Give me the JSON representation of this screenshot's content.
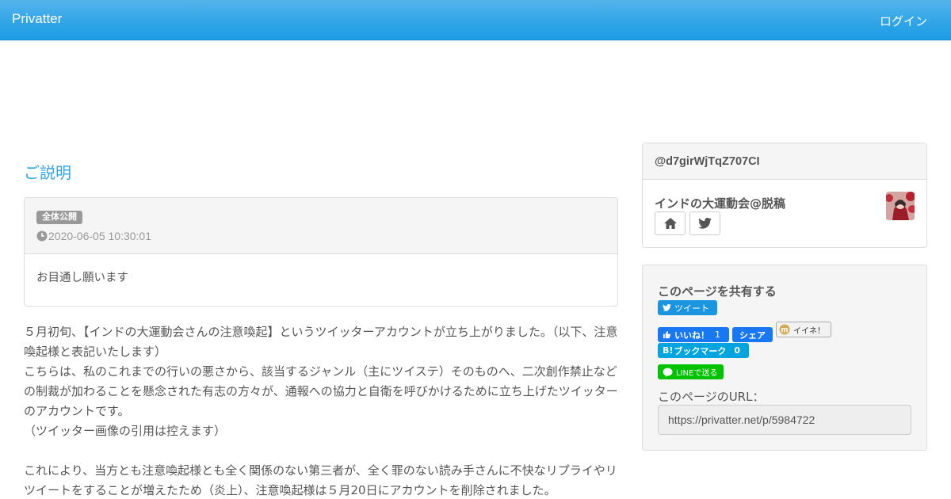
{
  "navbar": {
    "brand": "Privatter",
    "login": "ログイン"
  },
  "post": {
    "title": "ご説明",
    "badge": "全体公開",
    "date": "2020-06-05 10:30:01",
    "summary": "お目通し願います",
    "paragraphs": [
      "５月初旬、【インドの大運動会さんの注意喚起】というツイッターアカウントが立ち上がりました。（以下、注意喚起様と表記いたします）\nこちらは、私のこれまでの行いの悪さから、該当するジャンル（主にツイステ）そのものへ、二次創作禁止などの制裁が加わることを懸念された有志の方々が、通報への協力と自衛を呼びかけるために立ち上げたツイッターのアカウントです。\n（ツイッター画像の引用は控えます）",
      "これにより、当方とも注意喚起様とも全く関係のない第三者が、全く罪のない読み手さんに不快なリプライやリツイートをすることが増えたため（炎上）、注意喚起様は５月20日にアカウントを削除されました。"
    ]
  },
  "author": {
    "handle": "@d7girWjTqZ707CI",
    "name": "インドの大運動会@脱稿"
  },
  "share": {
    "title": "このページを共有する",
    "tweet": "ツイート",
    "fb_like": "いいね！",
    "fb_like_count": "1",
    "fb_share": "シェア",
    "mixi": "イイネ！",
    "hatena": "ブックマーク",
    "hatena_prefix": "B!",
    "hatena_count": "0",
    "line": "LINEで送る",
    "url_label": "このページのURL：",
    "url": "https://privatter.net/p/5984722"
  },
  "colors": {
    "navbar": "#2fa4e7",
    "title": "#2fa4e7",
    "twitter": "#1b95e0",
    "facebook": "#1877f2",
    "hatena": "#00a4de",
    "line": "#00c300"
  }
}
